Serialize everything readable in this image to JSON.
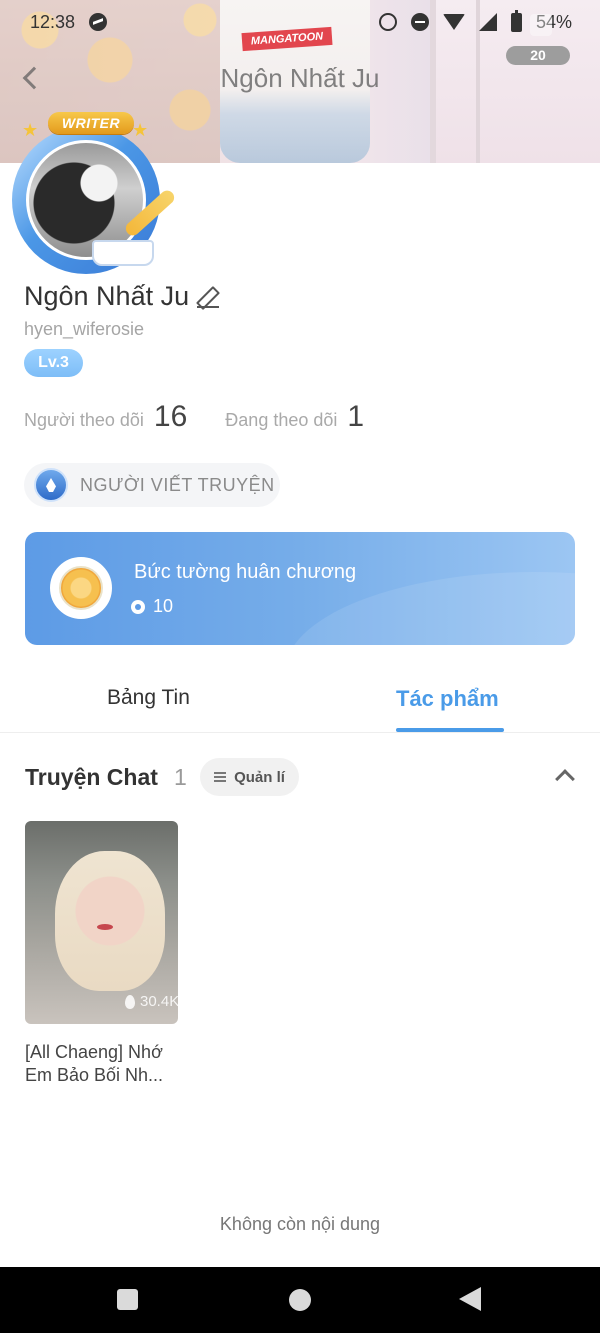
{
  "status_bar": {
    "time": "12:38",
    "battery": "54%",
    "icons": [
      "messenger-icon",
      "alarm-icon",
      "do-not-disturb-icon",
      "wifi-icon",
      "signal-icon",
      "battery-icon"
    ]
  },
  "header": {
    "title": "Ngôn Nhất Ju",
    "like_count": "20",
    "shirt_text": "MANGATOON"
  },
  "avatar": {
    "frame_badge": "WRITER"
  },
  "profile": {
    "name": "Ngôn Nhất Ju",
    "handle": "hyen_wiferosie",
    "level": "Lv.3",
    "followers_label": "Người theo dõi",
    "followers_value": "16",
    "following_label": "Đang theo dõi",
    "following_value": "1",
    "writer_tag": "NGƯỜI VIẾT TRUYỆN"
  },
  "medal_wall": {
    "title": "Bức tường huân chương",
    "count": "10"
  },
  "tabs": [
    {
      "label": "Bảng Tin",
      "active": false
    },
    {
      "label": "Tác phẩm",
      "active": true
    }
  ],
  "section": {
    "title": "Truyện Chat",
    "count": "1",
    "manage_label": "Quản lí"
  },
  "stories": [
    {
      "title": "[All Chaeng] Nhớ Em Bảo Bối Nh...",
      "views": "30.4K"
    }
  ],
  "footer_text": "Không còn nội dung",
  "colors": {
    "accent": "#4a9be8",
    "level_badge": "#8ac6fb",
    "medal_card_start": "#5d9be6",
    "medal_card_end": "#9cc6f3"
  }
}
